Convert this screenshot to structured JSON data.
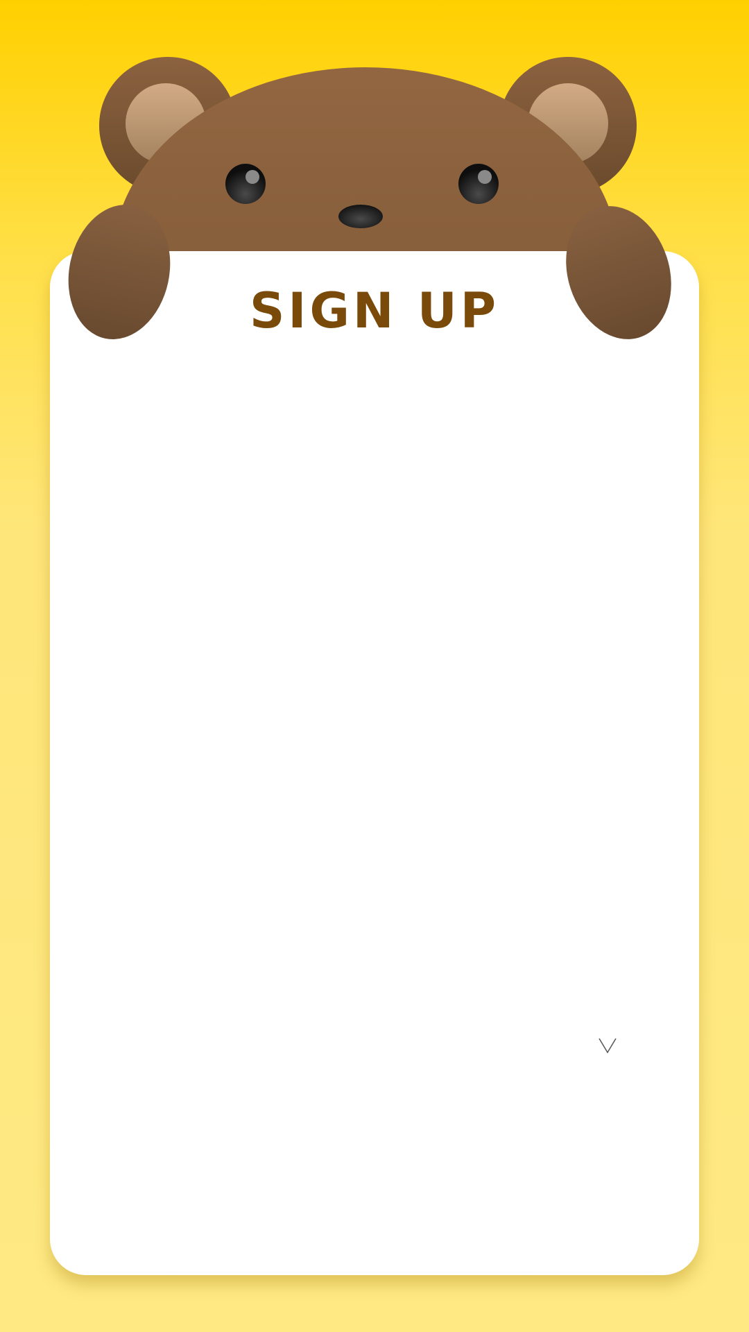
{
  "form": {
    "title": "SIGN UP",
    "toggle_icon": "chevron-down-icon"
  },
  "colors": {
    "background_top": "#ffd000",
    "background_bottom": "#fee983",
    "card": "#ffffff",
    "title": "#7a4a0a",
    "bear_fur": "#865f3d",
    "bear_inner_ear": "#c9a07a",
    "bear_eye": "#141414"
  },
  "mascot": {
    "icon": "bear-icon"
  }
}
